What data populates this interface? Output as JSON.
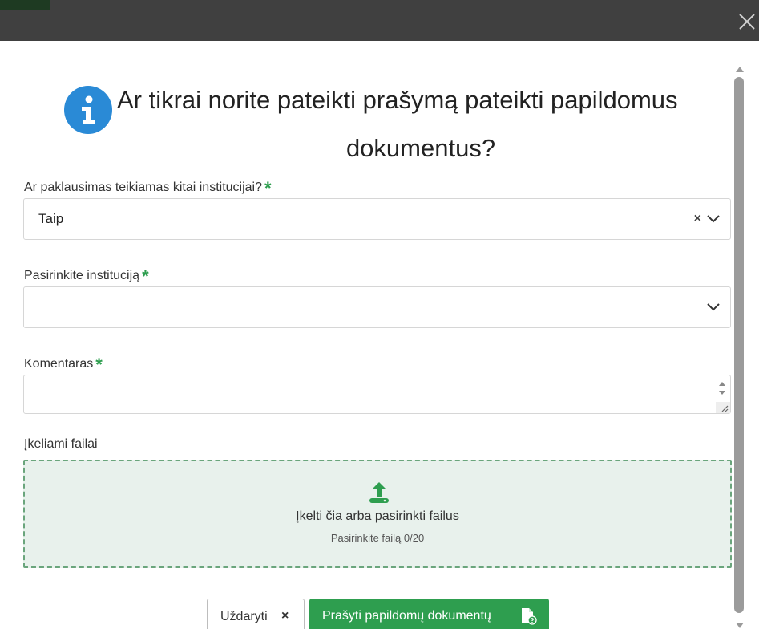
{
  "dialog": {
    "heading_line1": "Ar tikrai norite pateikti prašymą pateikti papildomus",
    "heading_line2": "dokumentus?",
    "close_icon": "close-icon",
    "info_icon": "info-icon"
  },
  "form": {
    "institution_question": {
      "label": "Ar paklausimas teikiamas kitai institucijai?",
      "required_mark": "*",
      "value": "Taip",
      "clear_label": "×"
    },
    "institution_select": {
      "label": "Pasirinkite instituciją",
      "required_mark": "*",
      "value": ""
    },
    "comment": {
      "label": "Komentaras",
      "required_mark": "*",
      "value": ""
    },
    "files": {
      "label": "Įkeliami failai",
      "dropzone_text": "Įkelti čia arba pasirinkti failus",
      "dropzone_sub": "Pasirinkite failą 0/20"
    }
  },
  "footer": {
    "close_label": "Uždaryti",
    "close_icon_glyph": "×",
    "request_label": "Prašyti papildomų dokumentų"
  },
  "colors": {
    "accent": "#2e9e4f",
    "info_blue": "#2a8ad6",
    "topbar": "#404040",
    "dropzone_bg": "#e8f1ec"
  }
}
